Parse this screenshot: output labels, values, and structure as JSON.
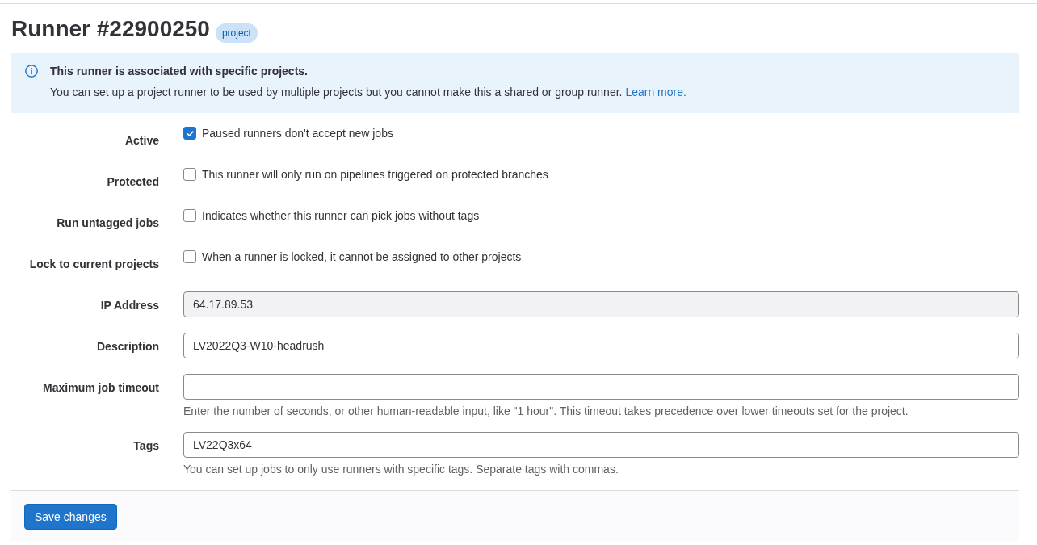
{
  "page": {
    "title": "Runner #22900250",
    "badge": "project"
  },
  "alert": {
    "title": "This runner is associated with specific projects.",
    "message": "You can set up a project runner to be used by multiple projects but you cannot make this a shared or group runner.",
    "link": "Learn more."
  },
  "form": {
    "fields": [
      {
        "kind": "checkbox",
        "label": "Active",
        "text": "Paused runners don't accept new jobs",
        "checked": true
      },
      {
        "kind": "checkbox",
        "label": "Protected",
        "text": "This runner will only run on pipelines triggered on protected branches",
        "checked": false
      },
      {
        "kind": "checkbox",
        "label": "Run untagged jobs",
        "text": "Indicates whether this runner can pick jobs without tags",
        "checked": false
      },
      {
        "kind": "checkbox",
        "label": "Lock to current projects",
        "text": "When a runner is locked, it cannot be assigned to other projects",
        "checked": false
      },
      {
        "kind": "input",
        "label": "IP Address",
        "value": "64.17.89.53",
        "readonly": true
      },
      {
        "kind": "input",
        "label": "Description",
        "value": "LV2022Q3-W10-headrush",
        "readonly": false
      },
      {
        "kind": "input",
        "label": "Maximum job timeout",
        "readonly": false,
        "help": "Enter the number of seconds, or other human-readable input, like \"1 hour\". This timeout takes precedence over lower timeouts set for the project."
      },
      {
        "kind": "input",
        "label": "Tags",
        "value": "LV22Q3x64",
        "readonly": false,
        "help": "You can set up jobs to only use runners with specific tags. Separate tags with commas."
      }
    ]
  },
  "footer": {
    "button": "Save changes"
  }
}
